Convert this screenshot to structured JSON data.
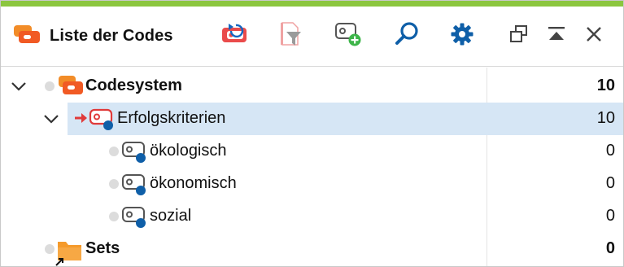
{
  "window": {
    "accent_color": "#8cc63f"
  },
  "header": {
    "title": "Liste der Codes",
    "title_icon": "code-list-icon"
  },
  "toolbar": {
    "buttons": [
      {
        "name": "undo-activation-icon"
      },
      {
        "name": "filter-document-icon"
      },
      {
        "name": "new-code-icon"
      },
      {
        "name": "search-icon"
      },
      {
        "name": "settings-gear-icon"
      },
      {
        "name": "undock-window-icon"
      },
      {
        "name": "maximize-up-icon"
      },
      {
        "name": "close-icon"
      }
    ]
  },
  "tree": {
    "rows": [
      {
        "label": "Codesystem",
        "count": "10",
        "bold": true,
        "expanded": true,
        "icon": "code-system-icon"
      },
      {
        "label": "Erfolgskriterien",
        "count": "10",
        "bold": false,
        "expanded": true,
        "selected": true,
        "icon": "code-tag-icon",
        "icon_color": "#e03a3a",
        "activated_marker": "activation-arrow-icon"
      },
      {
        "label": "ökologisch",
        "count": "0",
        "bold": false,
        "icon": "code-tag-icon"
      },
      {
        "label": "ökonomisch",
        "count": "0",
        "bold": false,
        "icon": "code-tag-icon"
      },
      {
        "label": "sozial",
        "count": "0",
        "bold": false,
        "icon": "code-tag-icon"
      },
      {
        "label": "Sets",
        "count": "0",
        "bold": true,
        "icon": "sets-folder-icon"
      }
    ]
  },
  "colors": {
    "selection": "#d6e6f5",
    "code_memo_dot": "#1565c0",
    "activation": "#e03a3a",
    "folder": "#f59a2b",
    "icon_blue": "#0f5fa8"
  }
}
